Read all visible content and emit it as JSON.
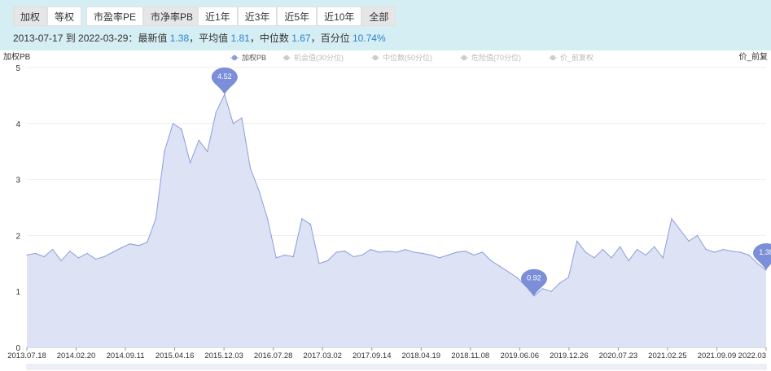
{
  "toolbar": {
    "weight_tabs": [
      {
        "label": "加权",
        "active": false
      },
      {
        "label": "等权",
        "active": true
      }
    ],
    "metric_tabs": [
      {
        "label": "市盈率PE",
        "active": true
      },
      {
        "label": "市净率PB",
        "active": false
      }
    ],
    "range_tabs": [
      {
        "label": "近1年",
        "active": true
      },
      {
        "label": "近3年",
        "active": true
      },
      {
        "label": "近5年",
        "active": true
      },
      {
        "label": "近10年",
        "active": true
      },
      {
        "label": "全部",
        "active": false
      }
    ]
  },
  "summary": {
    "range_text": "2013-07-17 到 2022-03-29：",
    "latest_label": "最新值 ",
    "latest_value": "1.38",
    "sep1": "，",
    "mean_label": "平均值 ",
    "mean_value": "1.81",
    "sep2": "，",
    "median_label": "中位数 ",
    "median_value": "1.67",
    "sep3": "，",
    "pct_label": "百分位 ",
    "pct_value": "10.74%"
  },
  "colors": {
    "series": "#8c9edb",
    "fill": "#dde2f5",
    "pin": "#7b8fd8",
    "legend_inactive": "#cccccc",
    "axis_text": "#333333",
    "grid": "#eeeeee",
    "topbar": "#d5eef3",
    "value": "#2f7fd2"
  },
  "chart_data": {
    "type": "area",
    "ylabel": "加权PB",
    "right_label": "价_前复",
    "ylim": [
      0,
      5
    ],
    "yticks": [
      0,
      1,
      2,
      3,
      4,
      5
    ],
    "xticks": [
      "2013.07.18",
      "2014.02.20",
      "2014.09.11",
      "2015.04.16",
      "2015.12.03",
      "2016.07.28",
      "2017.03.02",
      "2017.09.14",
      "2018.04.19",
      "2018.11.08",
      "2019.06.06",
      "2019.12.26",
      "2020.07.23",
      "2021.02.25",
      "2021.09.09",
      "2022.03"
    ],
    "legend": [
      {
        "name": "加权PB",
        "active": true
      },
      {
        "name": "机会值(30分位)",
        "active": false
      },
      {
        "name": "中位数(50分位)",
        "active": false
      },
      {
        "name": "危险值(70分位)",
        "active": false
      },
      {
        "name": "价_前复权",
        "active": false
      }
    ],
    "series": [
      {
        "name": "加权PB",
        "x": [
          "2013.07.18",
          "2013.08.15",
          "2013.09.12",
          "2013.10.10",
          "2013.11.07",
          "2013.12.05",
          "2014.01.02",
          "2014.02.20",
          "2014.03.20",
          "2014.04.17",
          "2014.05.15",
          "2014.06.12",
          "2014.07.10",
          "2014.08.07",
          "2014.09.11",
          "2014.10.09",
          "2014.11.06",
          "2014.11.27",
          "2014.12.18",
          "2015.01.08",
          "2015.01.29",
          "2015.02.19",
          "2015.03.12",
          "2015.04.16",
          "2015.04.30",
          "2015.05.14",
          "2015.05.28",
          "2015.06.11",
          "2015.07.02",
          "2015.07.23",
          "2015.08.20",
          "2015.09.17",
          "2015.10.15",
          "2015.11.05",
          "2015.11.19",
          "2015.12.03",
          "2015.12.31",
          "2016.01.21",
          "2016.02.25",
          "2016.03.24",
          "2016.04.21",
          "2016.05.19",
          "2016.06.23",
          "2016.07.28",
          "2016.09.22",
          "2016.11.17",
          "2017.01.12",
          "2017.03.02",
          "2017.05.04",
          "2017.06.29",
          "2017.08.24",
          "2017.09.14",
          "2017.11.09",
          "2018.01.04",
          "2018.02.22",
          "2018.04.19",
          "2018.06.14",
          "2018.08.09",
          "2018.10.04",
          "2018.11.08",
          "2018.12.06",
          "2019.01.03",
          "2019.02.14",
          "2019.03.14",
          "2019.04.11",
          "2019.05.09",
          "2019.06.06",
          "2019.07.25",
          "2019.09.19",
          "2019.11.14",
          "2019.12.26",
          "2020.02.20",
          "2020.04.16",
          "2020.06.11",
          "2020.07.23",
          "2020.08.20",
          "2020.10.15",
          "2020.12.10",
          "2021.02.25",
          "2021.04.22",
          "2021.06.17",
          "2021.08.12",
          "2021.09.09",
          "2021.11.04",
          "2021.12.30",
          "2022.02.24",
          "2022.03.29"
        ],
        "values": [
          1.65,
          1.68,
          1.62,
          1.75,
          1.55,
          1.72,
          1.6,
          1.68,
          1.58,
          1.62,
          1.7,
          1.78,
          1.85,
          1.82,
          1.88,
          2.3,
          3.5,
          4.0,
          3.9,
          3.3,
          3.7,
          3.5,
          4.2,
          4.52,
          4.0,
          4.1,
          3.2,
          2.8,
          2.3,
          1.6,
          1.65,
          1.62,
          2.3,
          2.2,
          1.5,
          1.55,
          1.7,
          1.72,
          1.62,
          1.65,
          1.75,
          1.7,
          1.72,
          1.7,
          1.75,
          1.7,
          1.68,
          1.65,
          1.6,
          1.65,
          1.7,
          1.72,
          1.65,
          1.7,
          1.55,
          1.45,
          1.35,
          1.25,
          1.1,
          0.92,
          1.05,
          1.0,
          1.15,
          1.25,
          1.9,
          1.7,
          1.6,
          1.75,
          1.6,
          1.8,
          1.55,
          1.75,
          1.65,
          1.8,
          1.6,
          2.3,
          2.1,
          1.9,
          2.0,
          1.75,
          1.7,
          1.75,
          1.72,
          1.7,
          1.65,
          1.5,
          1.38
        ]
      }
    ],
    "annotations": [
      {
        "label": "4.52",
        "x": "2015.04.16",
        "value": 4.52
      },
      {
        "label": "0.92",
        "x": "2018.11.08",
        "value": 0.92
      },
      {
        "label": "1.38",
        "x": "2022.03.29",
        "value": 1.38
      }
    ]
  }
}
